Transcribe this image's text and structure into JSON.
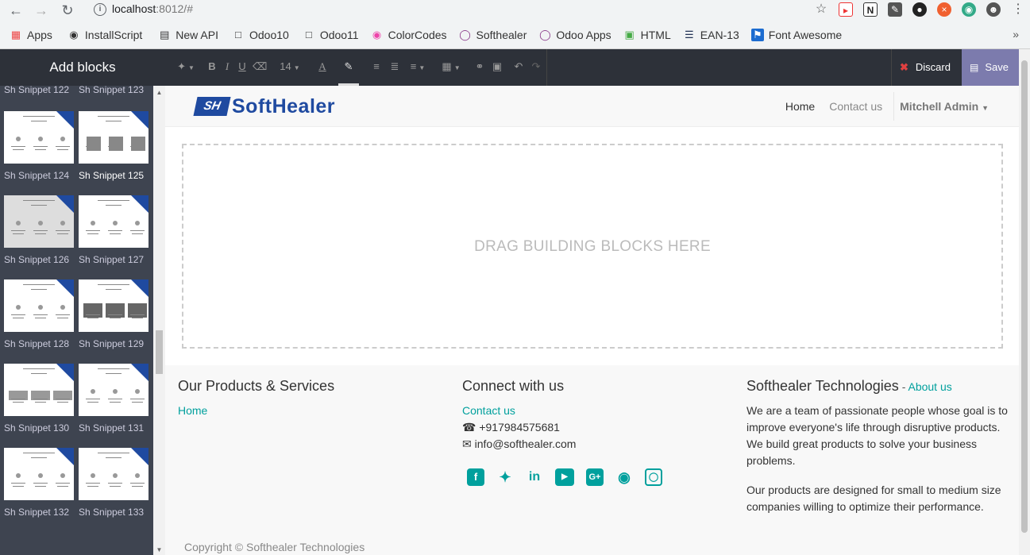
{
  "browser": {
    "url_host": "localhost",
    "url_rest": ":8012/#",
    "bookmarks": [
      "Apps",
      "InstallScript",
      "New API",
      "Odoo10",
      "Odoo11",
      "ColorCodes",
      "Softhealer",
      "Odoo Apps",
      "HTML",
      "EAN-13",
      "Font Awesome"
    ],
    "more": "»"
  },
  "sidebar": {
    "title": "Add blocks",
    "snippets": [
      {
        "label": "Sh Snippet 122"
      },
      {
        "label": "Sh Snippet 123"
      },
      {
        "label": "Sh Snippet 124"
      },
      {
        "label": "Sh Snippet 125"
      },
      {
        "label": "Sh Snippet 126"
      },
      {
        "label": "Sh Snippet 127"
      },
      {
        "label": "Sh Snippet 128"
      },
      {
        "label": "Sh Snippet 129"
      },
      {
        "label": "Sh Snippet 130"
      },
      {
        "label": "Sh Snippet 131"
      },
      {
        "label": "Sh Snippet 132"
      },
      {
        "label": "Sh Snippet 133"
      }
    ]
  },
  "toolbar": {
    "font_size": "14",
    "discard_label": "Discard",
    "save_label": "Save"
  },
  "site": {
    "logo_mark": "SH",
    "logo_text": "SoftHealer",
    "nav": {
      "home": "Home",
      "contact": "Contact us",
      "user": "Mitchell Admin"
    },
    "drop_zone": "DRAG BUILDING BLOCKS HERE"
  },
  "footer": {
    "col1_title": "Our Products & Services",
    "col1_link": "Home",
    "col2_title": "Connect with us",
    "col2_link": "Contact us",
    "phone": "+917984575681",
    "email": "info@softhealer.com",
    "col3_title": "Softhealer Technologies",
    "col3_dash": " - ",
    "col3_about": "About us",
    "para1": "We are a team of passionate people whose goal is to improve everyone's life through disruptive products. We build great products to solve your business problems.",
    "para2": "Our products are designed for small to medium size companies willing to optimize their performance.",
    "copyright": "Copyright © Softhealer Technologies"
  },
  "colors": {
    "accent": "#00a09d",
    "brand": "#1f4aa0",
    "save": "#7c7bad",
    "toolbar": "#2d3139"
  }
}
